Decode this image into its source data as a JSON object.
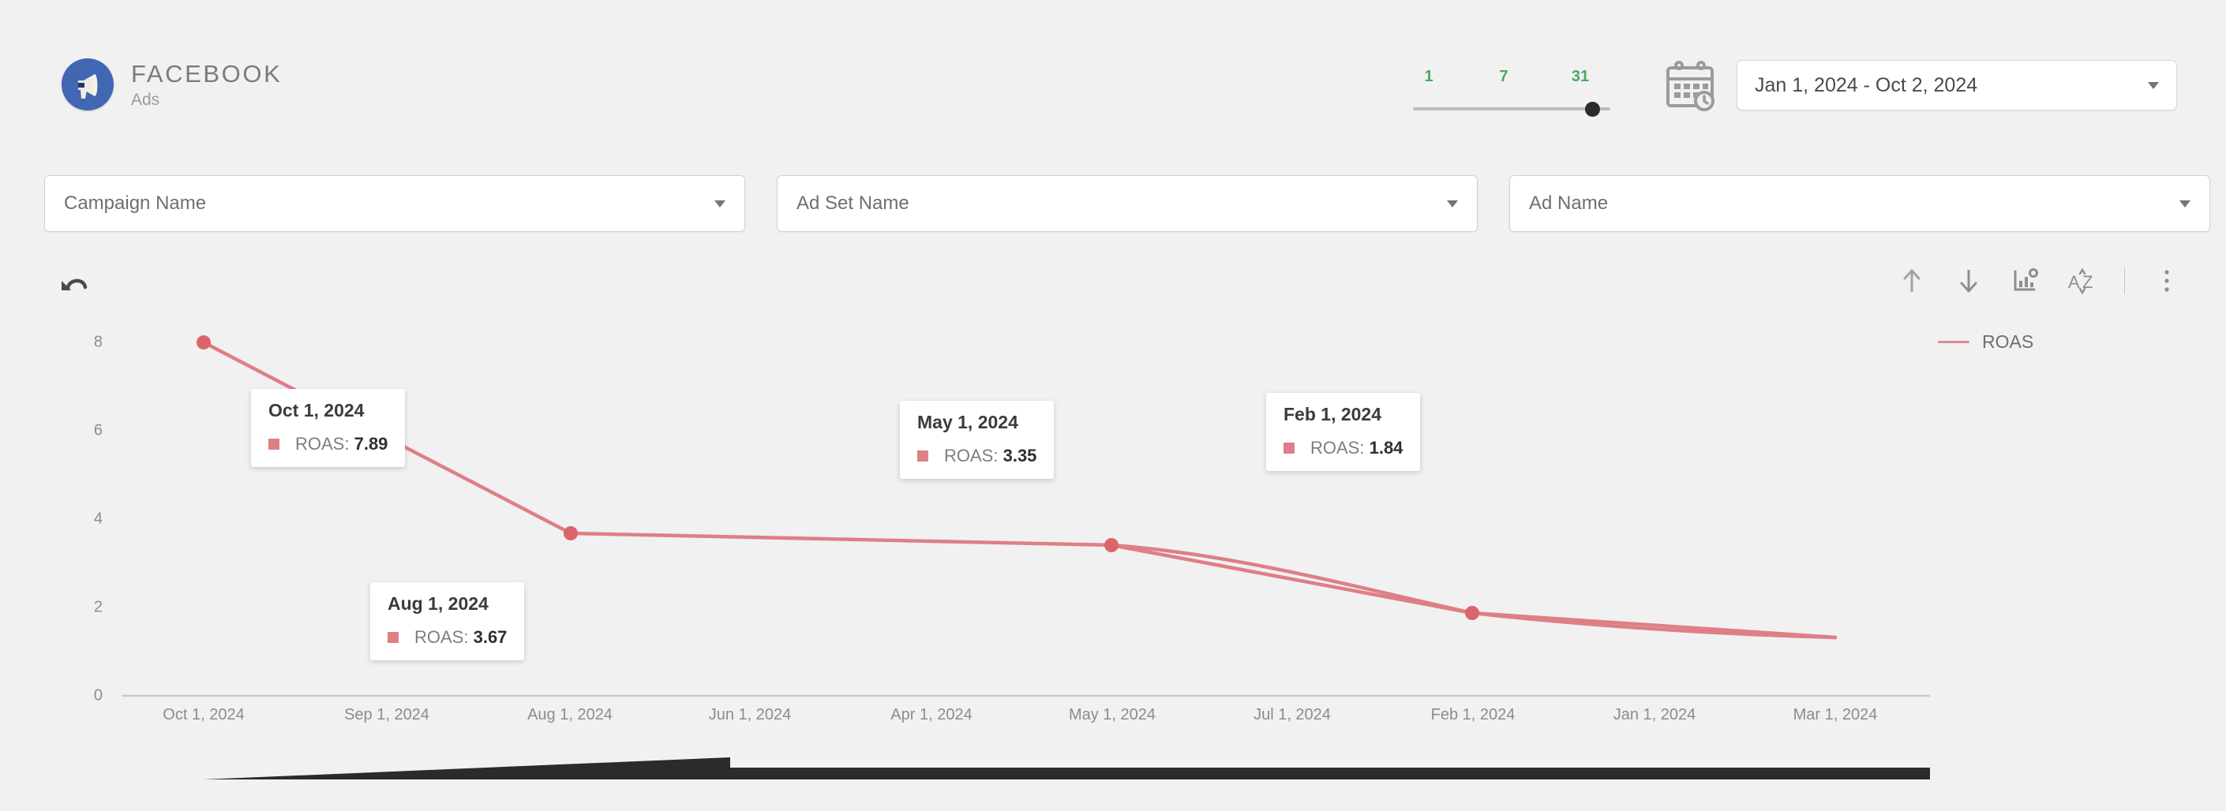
{
  "header": {
    "brand_name": "FACEBOOK",
    "brand_sub": "Ads",
    "brand_icon": "megaphone-icon",
    "brand_color": "#4267b2",
    "slider": {
      "ticks": [
        "1",
        "7",
        "31"
      ],
      "tick_color": "#49a860",
      "value": "31"
    },
    "calendar_icon": "calendar-icon",
    "date_range": {
      "value": "Jan 1, 2024 - Oct 2, 2024",
      "caret_icon": "chevron-down-icon"
    }
  },
  "filters": [
    {
      "label": "Campaign Name",
      "caret_icon": "chevron-down-icon"
    },
    {
      "label": "Ad Set Name",
      "caret_icon": "chevron-down-icon"
    },
    {
      "label": "Ad Name",
      "caret_icon": "chevron-down-icon"
    }
  ],
  "toolbar": {
    "undo_icon": "undo-icon",
    "tools": [
      {
        "icon": "arrow-up-icon"
      },
      {
        "icon": "arrow-down-icon"
      },
      {
        "icon": "chart-settings-icon"
      },
      {
        "icon": "sort-alpha-icon"
      },
      {
        "icon": "more-vertical-icon"
      }
    ]
  },
  "chart_data": {
    "type": "line",
    "title": "",
    "xlabel": "",
    "ylabel": "",
    "legend": [
      {
        "name": "ROAS",
        "color": "#de7f85"
      }
    ],
    "legend_position": "right",
    "grid": false,
    "ylim": [
      0,
      8
    ],
    "yticks": [
      "0",
      "2",
      "4",
      "6",
      "8"
    ],
    "categories": [
      "Oct 1, 2024",
      "Sep 1, 2024",
      "Aug 1, 2024",
      "Jun 1, 2024",
      "Apr 1, 2024",
      "May 1, 2024",
      "Jul 1, 2024",
      "Feb 1, 2024",
      "Jan 1, 2024",
      "Mar 1, 2024"
    ],
    "series": [
      {
        "name": "ROAS",
        "color": "#de7f85",
        "values": [
          7.89,
          5.55,
          3.67,
          3.57,
          3.48,
          3.35,
          2.55,
          1.84,
          1.62,
          1.35
        ]
      }
    ],
    "markers": [
      {
        "category": "Oct 1, 2024",
        "value": 7.89
      },
      {
        "category": "Aug 1, 2024",
        "value": 3.67
      },
      {
        "category": "May 1, 2024",
        "value": 3.35
      },
      {
        "category": "Feb 1, 2024",
        "value": 1.84
      }
    ],
    "annotations": [
      {
        "title": "Oct 1, 2024",
        "metric": "ROAS:",
        "value": "7.89"
      },
      {
        "title": "Aug 1, 2024",
        "metric": "ROAS:",
        "value": "3.67"
      },
      {
        "title": "May 1, 2024",
        "metric": "ROAS:",
        "value": "3.35"
      },
      {
        "title": "Feb 1, 2024",
        "metric": "ROAS:",
        "value": "1.84"
      }
    ]
  },
  "scrollbar": {
    "orientation": "horizontal",
    "color": "#2b2b2b"
  }
}
